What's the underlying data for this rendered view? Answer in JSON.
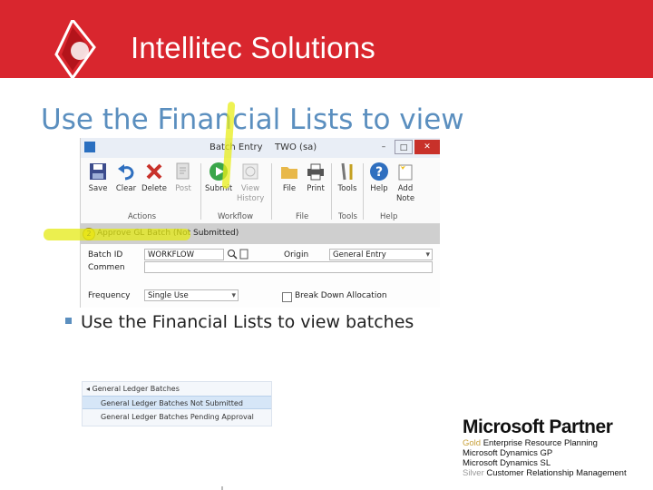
{
  "header": {
    "brand": "Intellitec Solutions",
    "colors": {
      "band": "#d9262e",
      "text": "#ffffff"
    }
  },
  "slide": {
    "title": "Use the Financial Lists to view",
    "bullet": "Use the Financial Lists to view batches",
    "colors": {
      "title": "#5b8fbf"
    }
  },
  "batch_window": {
    "title": "Batch Entry",
    "subtitle": "TWO (sa)",
    "ribbon": {
      "buttons": [
        {
          "label": "Save",
          "icon": "save-icon"
        },
        {
          "label": "Clear",
          "icon": "undo-icon"
        },
        {
          "label": "Delete",
          "icon": "delete-x-icon"
        },
        {
          "label": "Post",
          "icon": "post-icon"
        },
        {
          "label": "Submit",
          "icon": "submit-play-icon"
        },
        {
          "label": "View History",
          "icon": "history-icon"
        },
        {
          "label": "File",
          "icon": "folder-icon"
        },
        {
          "label": "Print",
          "icon": "printer-icon"
        },
        {
          "label": "Tools",
          "icon": "tools-icon"
        },
        {
          "label": "Help",
          "icon": "help-icon"
        },
        {
          "label": "Add Note",
          "icon": "note-icon"
        }
      ],
      "groups": [
        "Actions",
        "Workflow",
        "File",
        "Tools",
        "Help"
      ]
    },
    "status_text": "Approve GL Batch (Not Submitted)",
    "form": {
      "batch_id_label": "Batch ID",
      "batch_id_value": "WORKFLOW",
      "origin_label": "Origin",
      "origin_value": "General Entry",
      "comment_label": "Commen",
      "frequency_label": "Frequency",
      "frequency_value": "Single Use",
      "breakdown_label": "Break Down Allocation"
    }
  },
  "lists": {
    "header": "General Ledger Batches",
    "items": [
      "General Ledger Batches Not Submitted",
      "General Ledger Batches Pending Approval"
    ]
  },
  "partner": {
    "heading": "Microsoft Partner",
    "gold_word": "Gold",
    "gold_text": "Enterprise Resource Planning",
    "line2": "Microsoft Dynamics GP",
    "line3": "Microsoft Dynamics SL",
    "silver_word": "Silver",
    "silver_text": "Customer Relationship Management"
  }
}
